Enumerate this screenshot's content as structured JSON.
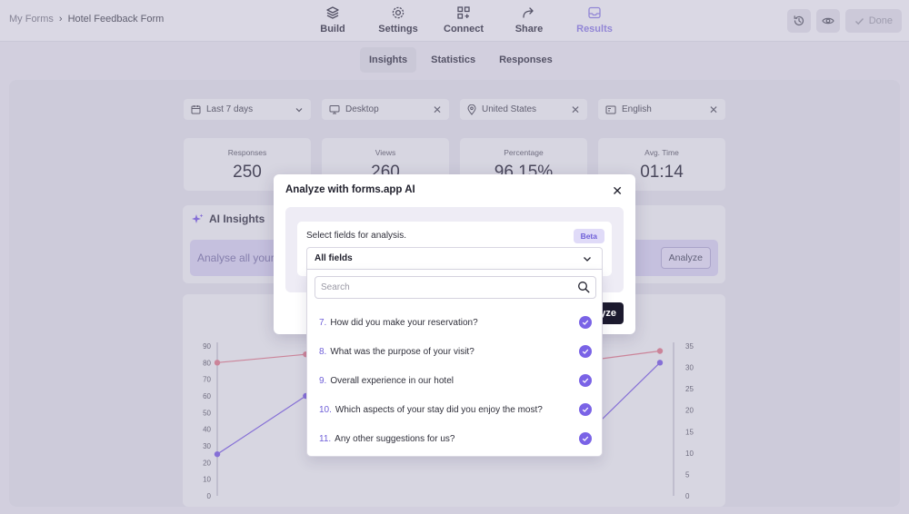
{
  "breadcrumb": {
    "root": "My Forms",
    "separator": "›",
    "current": "Hotel Feedback Form"
  },
  "nav": [
    {
      "label": "Build",
      "icon": "layers-icon"
    },
    {
      "label": "Settings",
      "icon": "gear-icon"
    },
    {
      "label": "Connect",
      "icon": "connect-icon"
    },
    {
      "label": "Share",
      "icon": "share-icon"
    },
    {
      "label": "Results",
      "icon": "inbox-icon",
      "active": true
    }
  ],
  "top_actions": {
    "history_icon": "history-icon",
    "preview_icon": "eye-icon",
    "done_label": "Done"
  },
  "subtabs": [
    {
      "label": "Insights",
      "active": true
    },
    {
      "label": "Statistics"
    },
    {
      "label": "Responses"
    }
  ],
  "filters": {
    "date": "Last 7 days",
    "device": "Desktop",
    "country": "United States",
    "language": "English"
  },
  "stats": [
    {
      "label": "Responses",
      "value": "250"
    },
    {
      "label": "Views",
      "value": "260"
    },
    {
      "label": "Percentage",
      "value": "96.15%"
    },
    {
      "label": "Avg. Time",
      "value": "01:14"
    }
  ],
  "ai_insights": {
    "title": "AI Insights",
    "prompt_text": "Analyse all your",
    "analyze_label": "Analyze"
  },
  "chart_data": {
    "type": "line",
    "y_left_ticks": [
      0,
      10,
      20,
      30,
      40,
      50,
      60,
      70,
      80,
      90
    ],
    "y_right_ticks": [
      0,
      5,
      10,
      15,
      20,
      25,
      30,
      35
    ],
    "ylim_left": [
      0,
      90
    ],
    "ylim_right": [
      0,
      35
    ],
    "series": [
      {
        "axis": "left",
        "color": "#e38a9a",
        "x": [
          0,
          1,
          4,
          5
        ],
        "y": [
          80,
          85,
          80,
          87
        ]
      },
      {
        "axis": "left",
        "color": "#8a6fe8",
        "x": [
          0,
          1,
          4,
          5
        ],
        "y": [
          25,
          60,
          28,
          80
        ]
      }
    ],
    "grid": false
  },
  "modal": {
    "title": "Analyze with forms.app AI",
    "field_label": "Select fields for analysis.",
    "beta": "Beta",
    "analyze_label": "Analyze",
    "select_value": "All fields",
    "search_placeholder": "Search",
    "options": [
      {
        "num": "7.",
        "label": "How did you make your reservation?",
        "checked": true
      },
      {
        "num": "8.",
        "label": "What was the purpose of your visit?",
        "checked": true
      },
      {
        "num": "9.",
        "label": "Overall experience in our hotel",
        "checked": true
      },
      {
        "num": "10.",
        "label": "Which aspects of your stay did you enjoy the most?",
        "checked": true
      },
      {
        "num": "11.",
        "label": "Any other suggestions for us?",
        "checked": true
      }
    ]
  }
}
